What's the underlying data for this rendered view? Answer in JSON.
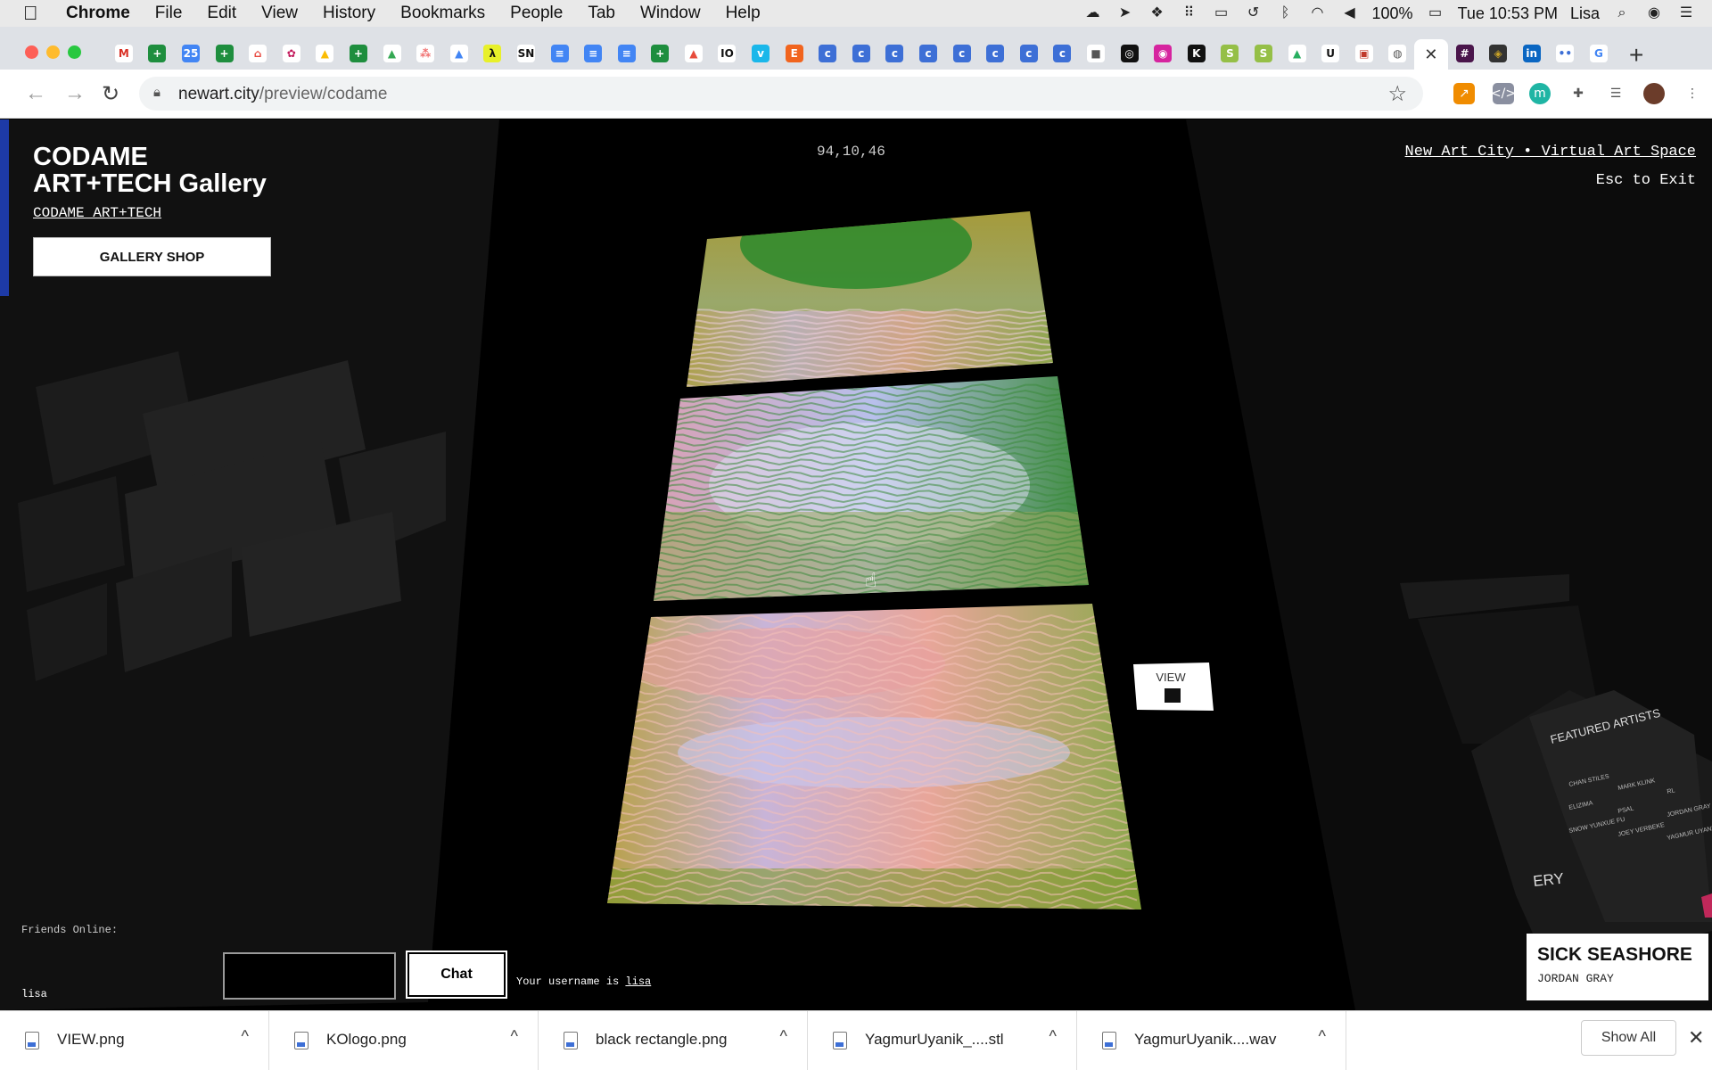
{
  "menubar": {
    "app": "Chrome",
    "items": [
      "File",
      "Edit",
      "View",
      "History",
      "Bookmarks",
      "People",
      "Tab",
      "Window",
      "Help"
    ],
    "battery": "100%",
    "clock": "Tue 10:53 PM",
    "user": "Lisa"
  },
  "tabs": {
    "favicons": [
      {
        "icon": "gmail-icon",
        "glyph": "M",
        "color": "#d93025",
        "bg": "#fff"
      },
      {
        "icon": "sheets-icon",
        "glyph": "+",
        "color": "#fff",
        "bg": "#1e8e3e"
      },
      {
        "icon": "calendar-icon",
        "glyph": "25",
        "color": "#fff",
        "bg": "#4285f4"
      },
      {
        "icon": "sheets-icon",
        "glyph": "+",
        "color": "#fff",
        "bg": "#1e8e3e"
      },
      {
        "icon": "store-icon",
        "glyph": "⌂",
        "color": "#e8453c",
        "bg": "#fff"
      },
      {
        "icon": "rose-icon",
        "glyph": "✿",
        "color": "#c2185b",
        "bg": "#fff"
      },
      {
        "icon": "drive-icon",
        "glyph": "▲",
        "color": "#fbbc04",
        "bg": "#fff"
      },
      {
        "icon": "sheets-icon",
        "glyph": "+",
        "color": "#fff",
        "bg": "#1e8e3e"
      },
      {
        "icon": "drive-icon",
        "glyph": "▲",
        "color": "#34a853",
        "bg": "#fff"
      },
      {
        "icon": "asana-icon",
        "glyph": "⁂",
        "color": "#f06a6a",
        "bg": "#fff"
      },
      {
        "icon": "drive-icon",
        "glyph": "▲",
        "color": "#4285f4",
        "bg": "#fff"
      },
      {
        "icon": "lambda-icon",
        "glyph": "λ",
        "color": "#111",
        "bg": "#e8f02a"
      },
      {
        "icon": "snark-icon",
        "glyph": "SN",
        "color": "#111",
        "bg": "#fff"
      },
      {
        "icon": "docs-icon",
        "glyph": "≡",
        "color": "#fff",
        "bg": "#4285f4"
      },
      {
        "icon": "docs-icon",
        "glyph": "≡",
        "color": "#fff",
        "bg": "#4285f4"
      },
      {
        "icon": "docs-icon",
        "glyph": "≡",
        "color": "#fff",
        "bg": "#4285f4"
      },
      {
        "icon": "sheets-icon",
        "glyph": "+",
        "color": "#fff",
        "bg": "#1e8e3e"
      },
      {
        "icon": "mountain-icon",
        "glyph": "▲",
        "color": "#e74c3c",
        "bg": "#fff"
      },
      {
        "icon": "io-icon",
        "glyph": "IO",
        "color": "#111",
        "bg": "#fff"
      },
      {
        "icon": "vimeo-icon",
        "glyph": "v",
        "color": "#fff",
        "bg": "#1ab7ea"
      },
      {
        "icon": "etsy-icon",
        "glyph": "E",
        "color": "#fff",
        "bg": "#f1641e"
      },
      {
        "icon": "c-icon",
        "glyph": "c",
        "color": "#fff",
        "bg": "#3d6fd6"
      },
      {
        "icon": "c-icon",
        "glyph": "c",
        "color": "#fff",
        "bg": "#3d6fd6"
      },
      {
        "icon": "c-icon",
        "glyph": "c",
        "color": "#fff",
        "bg": "#3d6fd6"
      },
      {
        "icon": "c-icon",
        "glyph": "c",
        "color": "#fff",
        "bg": "#3d6fd6"
      },
      {
        "icon": "c-icon",
        "glyph": "c",
        "color": "#fff",
        "bg": "#3d6fd6"
      },
      {
        "icon": "c-icon",
        "glyph": "c",
        "color": "#fff",
        "bg": "#3d6fd6"
      },
      {
        "icon": "c-icon",
        "glyph": "c",
        "color": "#fff",
        "bg": "#3d6fd6"
      },
      {
        "icon": "c-icon",
        "glyph": "c",
        "color": "#fff",
        "bg": "#3d6fd6"
      },
      {
        "icon": "cube-icon",
        "glyph": "■",
        "color": "#555",
        "bg": "#fff"
      },
      {
        "icon": "dribbble-icon",
        "glyph": "◎",
        "color": "#fff",
        "bg": "#111"
      },
      {
        "icon": "instagram-icon",
        "glyph": "◉",
        "color": "#fff",
        "bg": "#d6249f"
      },
      {
        "icon": "k-icon",
        "glyph": "K",
        "color": "#fff",
        "bg": "#111"
      },
      {
        "icon": "shopify-icon",
        "glyph": "S",
        "color": "#fff",
        "bg": "#95bf47"
      },
      {
        "icon": "shopify-icon",
        "glyph": "S",
        "color": "#fff",
        "bg": "#95bf47"
      },
      {
        "icon": "mountain-icon",
        "glyph": "▲",
        "color": "#27ae60",
        "bg": "#fff"
      },
      {
        "icon": "u-icon",
        "glyph": "U",
        "color": "#111",
        "bg": "#fff"
      },
      {
        "icon": "squares-icon",
        "glyph": "▣",
        "color": "#c0392b",
        "bg": "#fff"
      },
      {
        "icon": "globe-icon",
        "glyph": "◍",
        "color": "#555",
        "bg": "#fff"
      },
      {
        "icon": "close-icon",
        "glyph": "✕",
        "color": "#333",
        "bg": "#fff",
        "active": true
      },
      {
        "icon": "slack-icon",
        "glyph": "#",
        "color": "#fff",
        "bg": "#4a154b"
      },
      {
        "icon": "badge-icon",
        "glyph": "◈",
        "color": "#c9a227",
        "bg": "#333"
      },
      {
        "icon": "linkedin-icon",
        "glyph": "in",
        "color": "#fff",
        "bg": "#0a66c2"
      },
      {
        "icon": "dots-icon",
        "glyph": "••",
        "color": "#3d6fd6",
        "bg": "#fff"
      },
      {
        "icon": "google-icon",
        "glyph": "G",
        "color": "#4285f4",
        "bg": "#fff"
      }
    ]
  },
  "toolbar": {
    "url_host": "newart.city",
    "url_path": "/preview/codame"
  },
  "gallery": {
    "title": "CODAME\nART+TECH Gallery",
    "org_link": "CODAME ART+TECH",
    "shop_button": "GALLERY SHOP",
    "coords": "94,10,46",
    "site_link": "New Art City • Virtual Art Space",
    "exit_hint": "Esc to Exit",
    "view_sign": "VIEW",
    "featured_heading": "FEATURED ARTISTS",
    "featured_names": [
      "CHAN STILES",
      "MARK KLINK",
      "RL",
      "ELIZIMA",
      "PSAL",
      "JORDAN GRAY",
      "SNOW YUNXUE FU",
      "JOEY VERBEKE",
      "YAGMUR UYANIK"
    ],
    "wall_text": "ERY",
    "friends_label": "Friends Online:",
    "friends": [
      "lisa"
    ],
    "chat_button": "Chat",
    "chat_input_value": "",
    "username_prefix": "Your username is",
    "username": "lisa",
    "artwork_title": "SICK SEASHORE",
    "artwork_artist": "JORDAN GRAY"
  },
  "downloads": {
    "items": [
      "VIEW.png",
      "KOlogo.png",
      "black rectangle.png",
      "YagmurUyanik_....stl",
      "YagmurUyanik....wav"
    ],
    "show_all": "Show All"
  }
}
